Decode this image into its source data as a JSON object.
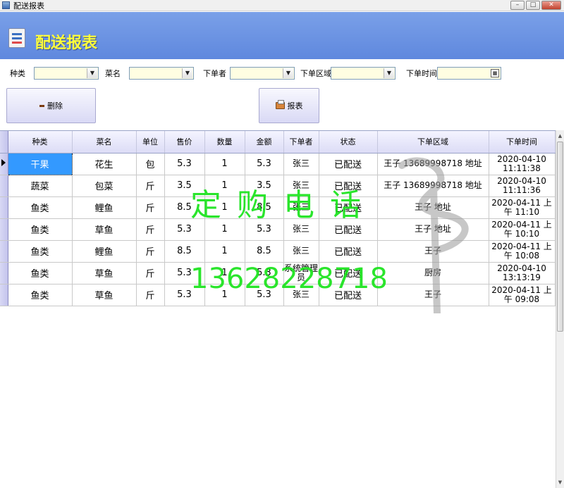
{
  "window": {
    "title": "配送报表",
    "minimize": "–",
    "maximize": "□",
    "close": "✕"
  },
  "header": {
    "title": "配送报表",
    "icon": "report-icon"
  },
  "filters": {
    "category_label": "种类",
    "dish_label": "菜名",
    "orderer_label": "下单者",
    "area_label": "下单区域",
    "time_label": "下单时间",
    "category_value": "",
    "dish_value": "",
    "orderer_value": "",
    "area_value": "",
    "time_value": ""
  },
  "toolbar": {
    "delete_label": "删除",
    "report_label": "报表"
  },
  "table": {
    "columns": [
      "种类",
      "菜名",
      "单位",
      "售价",
      "数量",
      "金额",
      "下单者",
      "状态",
      "下单区域",
      "下单时间"
    ],
    "rows": [
      [
        "干果",
        "花生",
        "包",
        "5.3",
        "1",
        "5.3",
        "张三",
        "已配送",
        "王子 13689998718 地址",
        "2020-04-10 11:11:38"
      ],
      [
        "蔬菜",
        "包菜",
        "斤",
        "3.5",
        "1",
        "3.5",
        "张三",
        "已配送",
        "王子 13689998718 地址",
        "2020-04-10 11:11:36"
      ],
      [
        "鱼类",
        "鲤鱼",
        "斤",
        "8.5",
        "1",
        "8.5",
        "张三",
        "已配送",
        "王子 地址",
        "2020-04-11 上午 11:10"
      ],
      [
        "鱼类",
        "草鱼",
        "斤",
        "5.3",
        "1",
        "5.3",
        "张三",
        "已配送",
        "王子 地址",
        "2020-04-11 上午 10:10"
      ],
      [
        "鱼类",
        "鲤鱼",
        "斤",
        "8.5",
        "1",
        "8.5",
        "张三",
        "已配送",
        "王子",
        "2020-04-11 上午 10:08"
      ],
      [
        "鱼类",
        "草鱼",
        "斤",
        "5.3",
        "1",
        "5.3",
        "系统管理员",
        "已配送",
        "厨房",
        "2020-04-10 13:13:19"
      ],
      [
        "鱼类",
        "草鱼",
        "斤",
        "5.3",
        "1",
        "5.3",
        "张三",
        "已配送",
        "王子",
        "2020-04-11 上午 09:08"
      ]
    ]
  },
  "watermark": {
    "text": "定购电话",
    "phone": "13628228718"
  },
  "colors": {
    "header": "#6b93e2",
    "title_yellow": "#ffff3c",
    "selected": "#3399ff",
    "watermark": "#19e31b"
  }
}
